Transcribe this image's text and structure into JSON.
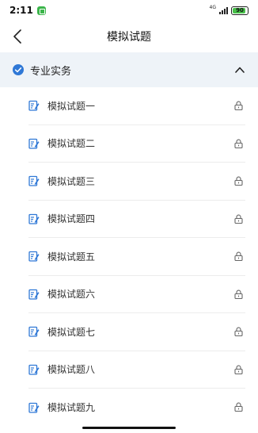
{
  "status_bar": {
    "time": "2:11",
    "network": "4G",
    "battery": "90",
    "battery_fraction": 0.9
  },
  "nav": {
    "title": "模拟试题",
    "back_icon": "chevron-left-icon"
  },
  "section": {
    "title": "专业实务",
    "check_icon": "check-circle-icon",
    "toggle_icon": "chevron-up-icon",
    "accent_color": "#2f78d6"
  },
  "items": [
    {
      "label": "模拟试题一"
    },
    {
      "label": "模拟试题二"
    },
    {
      "label": "模拟试题三"
    },
    {
      "label": "模拟试题四"
    },
    {
      "label": "模拟试题五"
    },
    {
      "label": "模拟试题六"
    },
    {
      "label": "模拟试题七"
    },
    {
      "label": "模拟试题八"
    },
    {
      "label": "模拟试题九"
    }
  ],
  "icons": {
    "item_icon": "edit-document-icon",
    "lock_icon": "lock-icon"
  }
}
